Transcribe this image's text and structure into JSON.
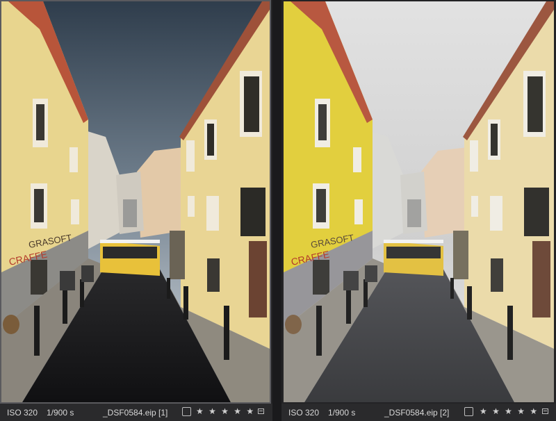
{
  "viewers": [
    {
      "iso": "ISO 320",
      "shutter": "1/900 s",
      "filename": "_DSF0584.eip [1]",
      "rating_stars": "★ ★ ★ ★ ★",
      "rating": 5,
      "style": "natural"
    },
    {
      "iso": "ISO 320",
      "shutter": "1/900 s",
      "filename": "_DSF0584.eip [2]",
      "rating_stars": "★ ★ ★ ★ ★",
      "rating": 5,
      "style": "muted"
    }
  ],
  "colors": {
    "background": "#1c1c1e",
    "infobar": "#2a2a2c",
    "text": "#d8d8d8"
  }
}
